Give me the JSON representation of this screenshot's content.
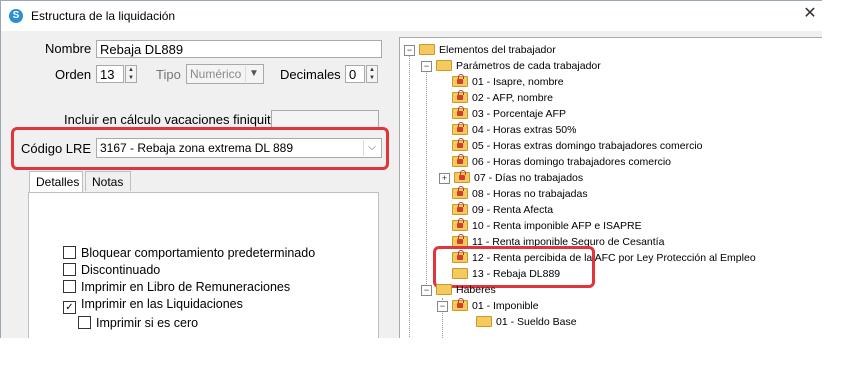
{
  "window": {
    "title": "Estructura de la liquidación",
    "close_glyph": "✕",
    "app_icon": "app-logo-icon"
  },
  "form": {
    "nombre_label": "Nombre",
    "nombre_value": "Rebaja DL889",
    "orden_label": "Orden",
    "orden_value": "13",
    "tipo_label": "Tipo",
    "tipo_value": "Numérico",
    "decimales_label": "Decimales",
    "decimales_value": "0",
    "vacaciones_label": "Incluir en cálculo vacaciones finiquito",
    "codigo_lre_label": "Código LRE",
    "codigo_lre_value": "3167 - Rebaja zona extrema DL 889"
  },
  "tabs": [
    {
      "label": "Detalles"
    },
    {
      "label": "Notas"
    }
  ],
  "checkboxes": [
    {
      "label": "Bloquear comportamiento predeterminado",
      "checked": false
    },
    {
      "label": "Discontinuado",
      "checked": false
    },
    {
      "label": "Imprimir en Libro de Remuneraciones",
      "checked": false
    },
    {
      "label": "Imprimir en las Liquidaciones",
      "checked": true
    },
    {
      "label": "Imprimir si es cero",
      "checked": false
    }
  ],
  "check_mark": "✓",
  "tree": {
    "root": "Elementos del trabajador",
    "group1": "Parámetros de cada trabajador",
    "items": [
      "01 - Isapre, nombre",
      "02 - AFP, nombre",
      "03 - Porcentaje AFP",
      "04 - Horas extras 50%",
      "05 - Horas extras domingo trabajadores comercio",
      "06 - Horas domingo trabajadores comercio",
      "07 - Días no trabajados",
      "08 - Horas no trabajadas",
      "09 - Renta Afecta",
      "10 - Renta imponible AFP e ISAPRE",
      "11 - Renta imponible Seguro de Cesantía",
      "12 - Renta percibida de la AFC por Ley Protección al Empleo",
      "13 - Rebaja DL889"
    ],
    "group2": "Haberes",
    "group2_child": "01 - Imponible",
    "group2_grandchild": "01 - Sueldo Base",
    "collapse_glyph": "−",
    "expand_glyph": "+"
  },
  "colors": {
    "highlight": "#e0363b",
    "folder": "#f4c95d",
    "lock": "#d63c2c"
  }
}
